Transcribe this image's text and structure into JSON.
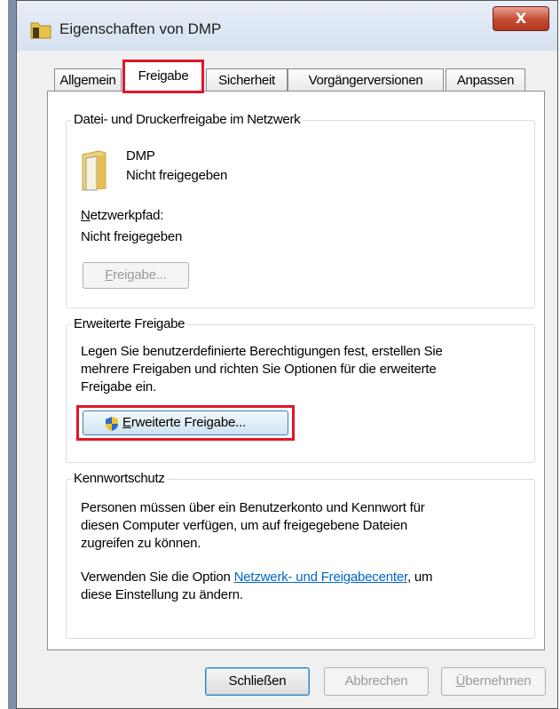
{
  "window": {
    "title": "Eigenschaften von DMP",
    "close_label": "X"
  },
  "tabs": [
    {
      "label": "Allgemein"
    },
    {
      "label": "Freigabe",
      "active": true
    },
    {
      "label": "Sicherheit"
    },
    {
      "label": "Vorgängerversionen"
    },
    {
      "label": "Anpassen"
    }
  ],
  "network_sharing": {
    "group_title": "Datei- und Druckerfreigabe im Netzwerk",
    "folder_name": "DMP",
    "folder_status": "Nicht freigegeben",
    "path_label_first": "N",
    "path_label_rest": "etzwerkpfad:",
    "path_value": "Nicht freigegeben",
    "share_button_first": "F",
    "share_button_rest": "reigabe..."
  },
  "advanced_sharing": {
    "group_title": "Erweiterte Freigabe",
    "description_line1": "Legen Sie benutzerdefinierte Berechtigungen fest, erstellen Sie",
    "description_line2": "mehrere Freigaben und richten Sie Optionen für die erweiterte",
    "description_line3": "Freigabe ein.",
    "button_first": "E",
    "button_rest": "rweiterte Freigabe..."
  },
  "password_protection": {
    "group_title": "Kennwortschutz",
    "line1": "Personen müssen über ein Benutzerkonto und Kennwort für",
    "line2": "diesen Computer verfügen, um auf freigegebene Dateien",
    "line3": "zugreifen zu können.",
    "line4_prefix": "Verwenden Sie die Option ",
    "link_text": "Netzwerk- und Freigabecenter",
    "line4_suffix": ", um",
    "line5": "diese Einstellung zu ändern."
  },
  "footer": {
    "close_button": "Schließen",
    "cancel_button": "Abbrechen",
    "apply_first": "Ü",
    "apply_rest": "bernehmen"
  },
  "colors": {
    "highlight": "#e0162b",
    "link": "#0066cc",
    "close_button": "#c44a32"
  }
}
